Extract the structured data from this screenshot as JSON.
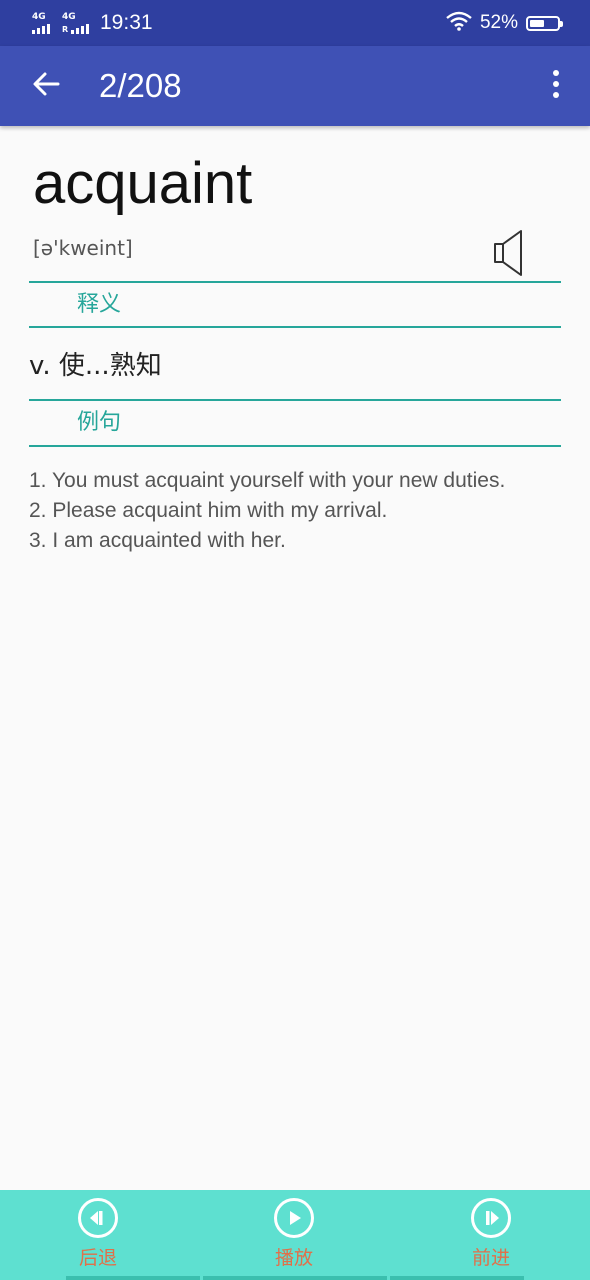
{
  "status_bar": {
    "network_1": "4G",
    "network_2": "4G",
    "time": "19:31",
    "battery_percent_text": "52%",
    "battery_level": 0.52,
    "icons": [
      "signal-icon",
      "roaming-signal-icon",
      "wifi-icon",
      "battery-icon"
    ]
  },
  "app_bar": {
    "title": "2/208",
    "back_icon": "arrow-left-icon",
    "menu_icon": "more-vertical-icon",
    "color": "#3f51b5"
  },
  "word": {
    "text": "acquaint",
    "phonetic": "[ə'kweint]",
    "speaker_icon": "speaker-icon"
  },
  "sections": {
    "meaning_label": "释义",
    "example_label": "例句"
  },
  "definition": "v. 使...熟知",
  "examples": [
    "1. You must acquaint yourself with your new duties.",
    "2. Please acquaint him with my arrival.",
    "3. I am acquainted with her."
  ],
  "bottom_bar": {
    "back_label": "后退",
    "play_label": "播放",
    "forward_label": "前进",
    "background": "#5ee0d0",
    "label_color": "#e0704a"
  },
  "accent_color": "#26a69a"
}
